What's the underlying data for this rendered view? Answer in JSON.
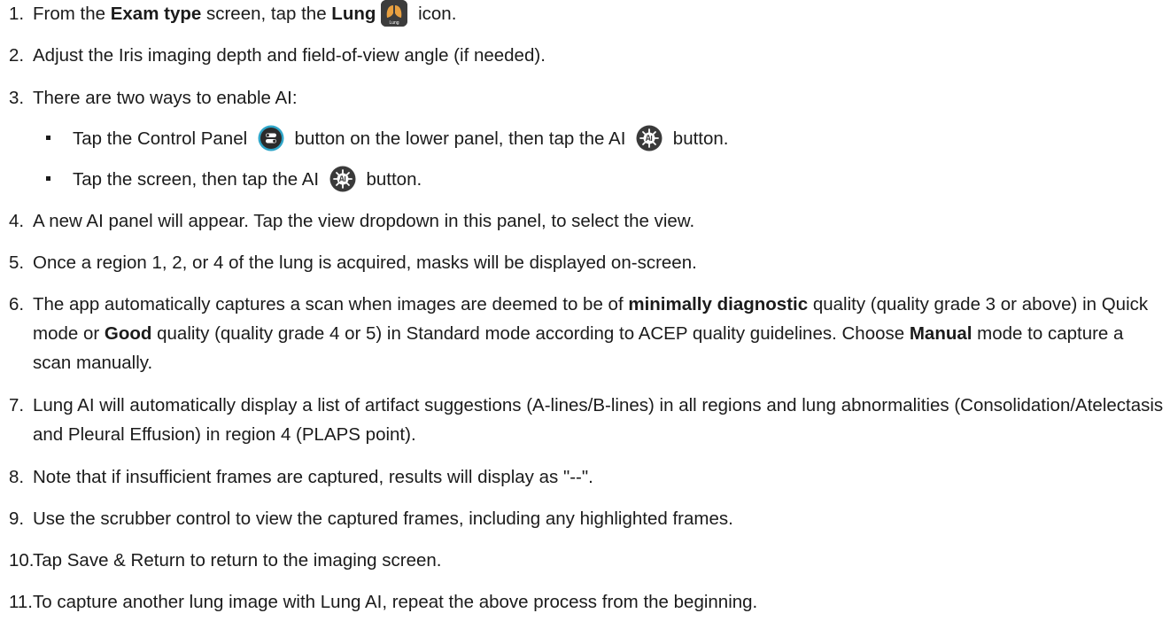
{
  "steps": [
    {
      "num": "1.",
      "a": "From the ",
      "b1": "Exam type",
      "c": " screen, tap the ",
      "b2": "Lung",
      "icon": "lung-icon",
      "icon_label": "Lung",
      "d": " icon."
    },
    {
      "num": "2.",
      "text": "Adjust the Iris imaging depth and field-of-view angle (if needed)."
    },
    {
      "num": "3.",
      "text": "There are two ways to enable AI:"
    },
    {
      "num": "4.",
      "text": "A new AI panel will appear. Tap the view dropdown in this panel, to select the view."
    },
    {
      "num": "5.",
      "text": "Once a region 1, 2, or 4 of the lung is acquired, masks will be displayed on-screen."
    },
    {
      "num": "6.",
      "a": "The app automatically captures a scan when images are deemed to be of ",
      "b1": "minimally diagnostic",
      "c": " quality (quality grade 3 or above) in Quick mode or ",
      "b2": "Good",
      "d": " quality (quality grade 4 or 5) in Standard mode according to ACEP quality guidelines. Choose ",
      "b3": "Manual",
      "e": " mode to capture a scan manually."
    },
    {
      "num": "7.",
      "text": "Lung AI will automatically display a list of artifact suggestions (A-lines/B-lines) in all regions and lung abnormalities (Consolidation/Atelectasis and Pleural Effusion) in region 4 (PLAPS point)."
    },
    {
      "num": "8.",
      "text": "Note that if insufficient frames are captured, results will display as \"--\"."
    },
    {
      "num": "9.",
      "text": "Use the scrubber control to view the captured frames, including any highlighted frames."
    },
    {
      "num": "10.",
      "text": "Tap Save & Return to return to the imaging screen."
    },
    {
      "num": "11.",
      "text": "To capture another lung image with Lung AI, repeat the above process from the beginning."
    }
  ],
  "substeps": [
    {
      "a": "Tap the Control Panel ",
      "icon": "control-panel-icon",
      "b": " button on the lower panel, then tap the AI ",
      "icon2": "ai-icon",
      "c": " button."
    },
    {
      "a": "Tap the screen, then tap the AI ",
      "icon": "ai-icon",
      "b": " button."
    }
  ],
  "colors": {
    "text": "#1b1b1b",
    "icon_dark": "#2b2b2b",
    "icon_accent": "#2fa6c9",
    "lung_icon": "#e8a040"
  }
}
